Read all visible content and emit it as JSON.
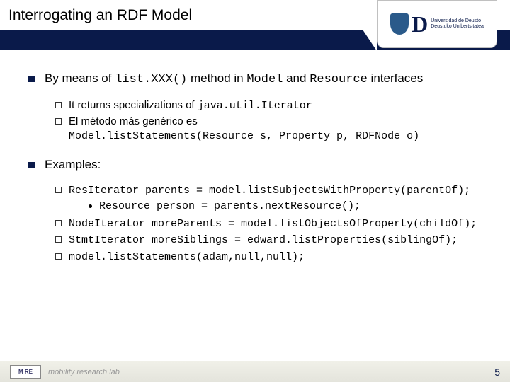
{
  "header": {
    "title": "Interrogating an RDF Model",
    "logo_uni_line1": "Universidad de Deusto",
    "logo_uni_line2": "Deustuko Unibertsitatea"
  },
  "b1": {
    "pre": "By means of ",
    "code1": "list.XXX()",
    "mid": " method in ",
    "code2": "Model",
    "and": " and ",
    "code3": "Resource",
    "post": " interfaces"
  },
  "b1s1": {
    "pre": "It returns specializations of ",
    "code": "java.util.Iterator"
  },
  "b1s2": {
    "pre": "El método más genérico es ",
    "code": "Model.listStatements(Resource s, Property p, RDFNode o)"
  },
  "b2": {
    "text": "Examples:"
  },
  "b2s1": {
    "code": "ResIterator parents = model.listSubjectsWithProperty(parentOf);"
  },
  "b2s1a": {
    "code": "Resource person = parents.nextResource();"
  },
  "b2s2": {
    "code": "NodeIterator moreParents = model.listObjectsOfProperty(childOf);"
  },
  "b2s3": {
    "code": "StmtIterator moreSiblings = edward.listProperties(siblingOf);"
  },
  "b2s4": {
    "code": "model.listStatements(adam,null,null);"
  },
  "footer": {
    "more": "M   RE",
    "lab": "mobility research lab",
    "page": "5"
  }
}
